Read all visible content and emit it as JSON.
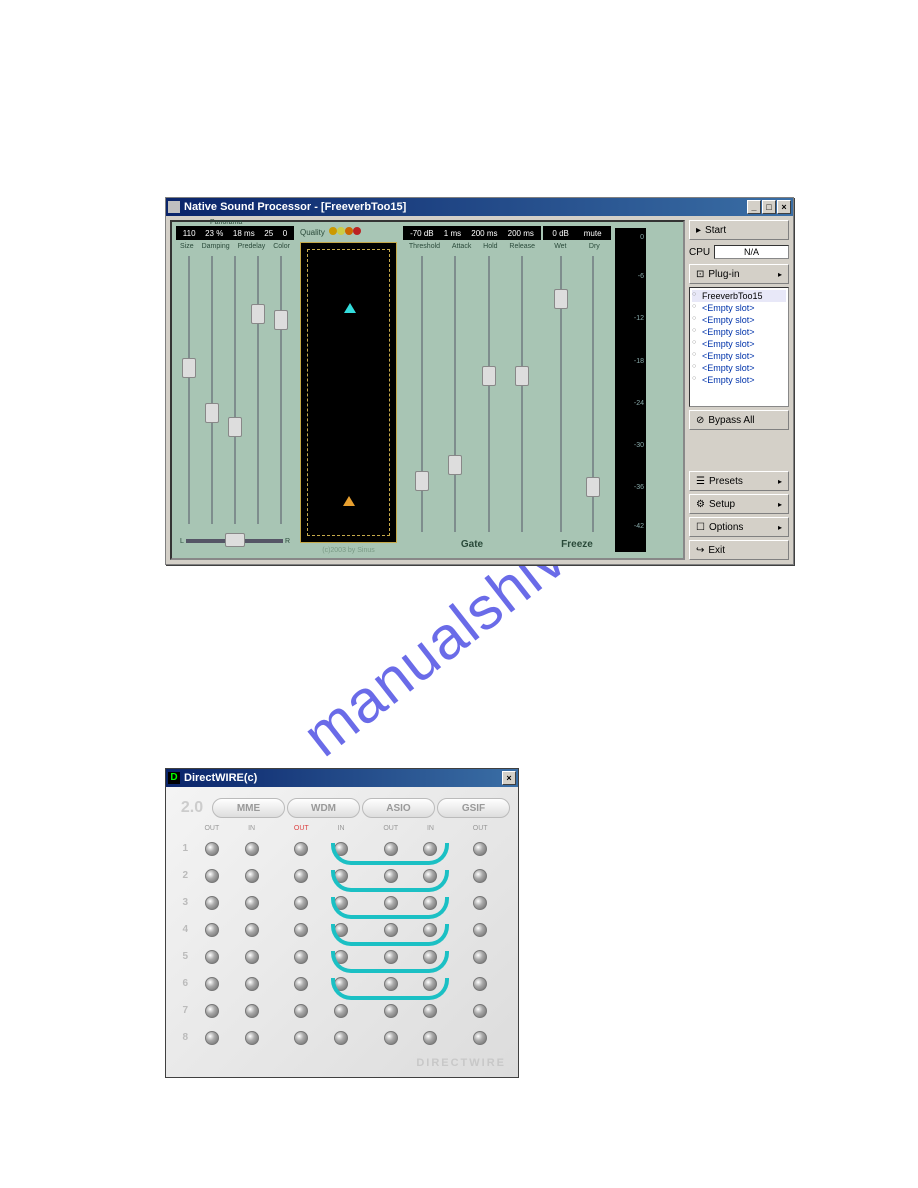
{
  "win1": {
    "title": "Native Sound Processor - [FreeverbToo15]",
    "room": {
      "readouts": [
        "110",
        "23 %",
        "18 ms",
        "25",
        "0"
      ],
      "labels": [
        "Size",
        "Damping",
        "Predelay",
        "Color"
      ],
      "panoramaLabel": "Panorama",
      "panoramaL": "L",
      "panoramaR": "R"
    },
    "quality": {
      "label": "Quality",
      "credit": "(c)2003 by Sinus"
    },
    "gate": {
      "readouts": [
        "-70 dB",
        "1 ms",
        "200 ms",
        "200 ms"
      ],
      "labels": [
        "Threshold",
        "Attack",
        "Hold",
        "Release"
      ],
      "footer": "Gate"
    },
    "freeze": {
      "readouts": [
        "0 dB",
        "mute"
      ],
      "labels": [
        "Wet",
        "Dry"
      ],
      "footer": "Freeze"
    },
    "meterTicks": [
      "0",
      "-6",
      "-12",
      "-18",
      "-24",
      "-30",
      "-36",
      "-42"
    ],
    "sidebar": {
      "start": "Start",
      "cpuLabel": "CPU",
      "cpuValue": "N/A",
      "plugin": "Plug-in",
      "bypass": "Bypass All",
      "presets": "Presets",
      "setup": "Setup",
      "options": "Options",
      "exit": "Exit",
      "slots": [
        "FreeverbToo15",
        "<Empty slot>",
        "<Empty slot>",
        "<Empty slot>",
        "<Empty slot>",
        "<Empty slot>",
        "<Empty slot>",
        "<Empty slot>"
      ]
    }
  },
  "win2": {
    "title": "DirectWIRE(c)",
    "version": "2.0",
    "tabs": [
      "MME",
      "WDM",
      "ASIO",
      "GSIF"
    ],
    "ports": [
      "OUT",
      "IN",
      "OUT",
      "IN",
      "OUT",
      "IN",
      "OUT"
    ],
    "rows": [
      "1",
      "2",
      "3",
      "4",
      "5",
      "6",
      "7",
      "8"
    ],
    "brand": "DIRECTWIRE"
  }
}
